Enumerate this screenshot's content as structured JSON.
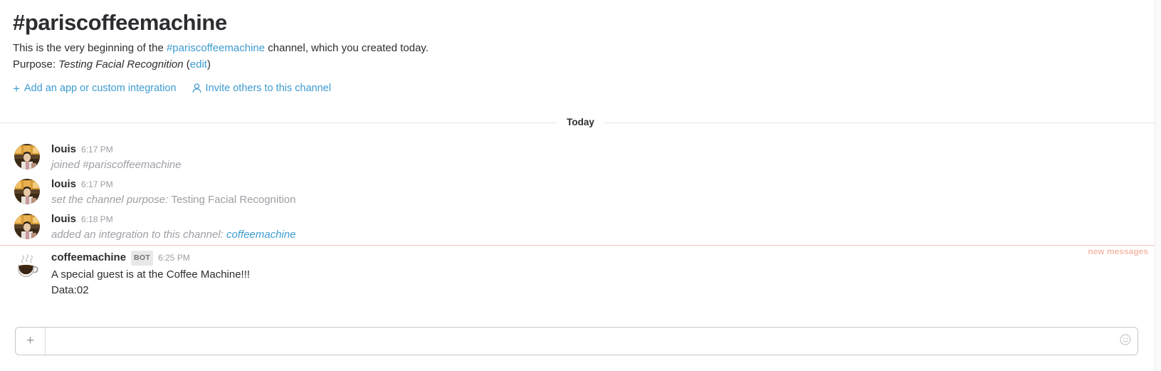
{
  "channel": {
    "title": "#pariscoffeemachine",
    "intro_prefix": "This is the very beginning of the ",
    "intro_link": "#pariscoffeemachine",
    "intro_suffix": " channel, which you created today.",
    "purpose_label": "Purpose: ",
    "purpose_value": "Testing Facial Recognition",
    "purpose_edit_open": " (",
    "purpose_edit": "edit",
    "purpose_edit_close": ")"
  },
  "actions": [
    {
      "icon": "plus-icon",
      "label": "Add an app or custom integration"
    },
    {
      "icon": "person-icon",
      "label": "Invite others to this channel"
    }
  ],
  "day_divider": {
    "label": "Today"
  },
  "messages": [
    {
      "avatar": "user-photo-avatar",
      "sender": "louis",
      "bot": false,
      "timestamp": "6:17 PM",
      "system": true,
      "text_italic": "joined #pariscoffeemachine",
      "text_plain": "",
      "link": ""
    },
    {
      "avatar": "user-photo-avatar",
      "sender": "louis",
      "bot": false,
      "timestamp": "6:17 PM",
      "system": true,
      "text_italic": "set the channel purpose: ",
      "text_plain": "Testing Facial Recognition",
      "link": ""
    },
    {
      "avatar": "user-photo-avatar",
      "sender": "louis",
      "bot": false,
      "timestamp": "6:18 PM",
      "system": true,
      "text_italic": "added an integration to this channel: ",
      "text_plain": "",
      "link": "coffeemachine"
    }
  ],
  "new_messages_divider": {
    "label": "new messages"
  },
  "bot_message": {
    "avatar": "coffee-cup-avatar",
    "sender": "coffeemachine",
    "badge": "BOT",
    "timestamp": "6:25 PM",
    "line1": "A special guest is at the Coffee Machine!!!",
    "line2": "Data:02"
  },
  "composer": {
    "plus": "+",
    "placeholder": "",
    "value": "",
    "emoji_icon": "smiley-icon"
  },
  "colors": {
    "link_blue": "#3d9bd1",
    "text_primary": "#2c2d30",
    "text_muted": "#9e9ea6",
    "new_messages": "#f5beae",
    "divider": "#e8e8e8"
  }
}
